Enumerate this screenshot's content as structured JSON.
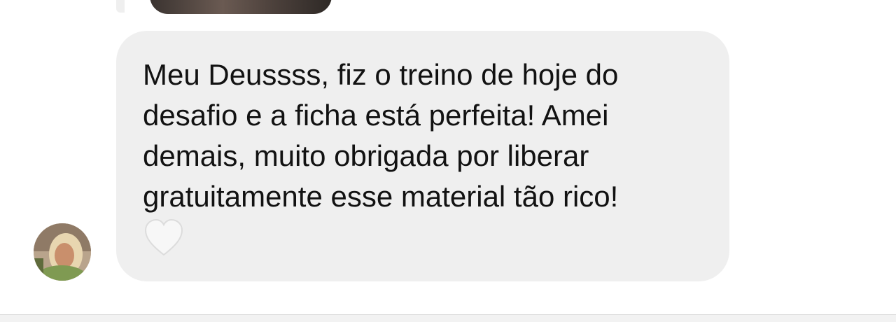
{
  "conversation": {
    "message": {
      "text": "Meu Deussss, fiz o treino de hoje do\ndesafio e a ficha está perfeita! Amei\ndemais, muito obrigada por liberar\ngratuitamente esse material tão rico!",
      "reaction_icon": "white-heart-icon"
    },
    "sender": {
      "avatar_icon": "profile-photo"
    }
  },
  "colors": {
    "bubble_bg": "#efefef",
    "text": "#121212",
    "background": "#ffffff"
  }
}
